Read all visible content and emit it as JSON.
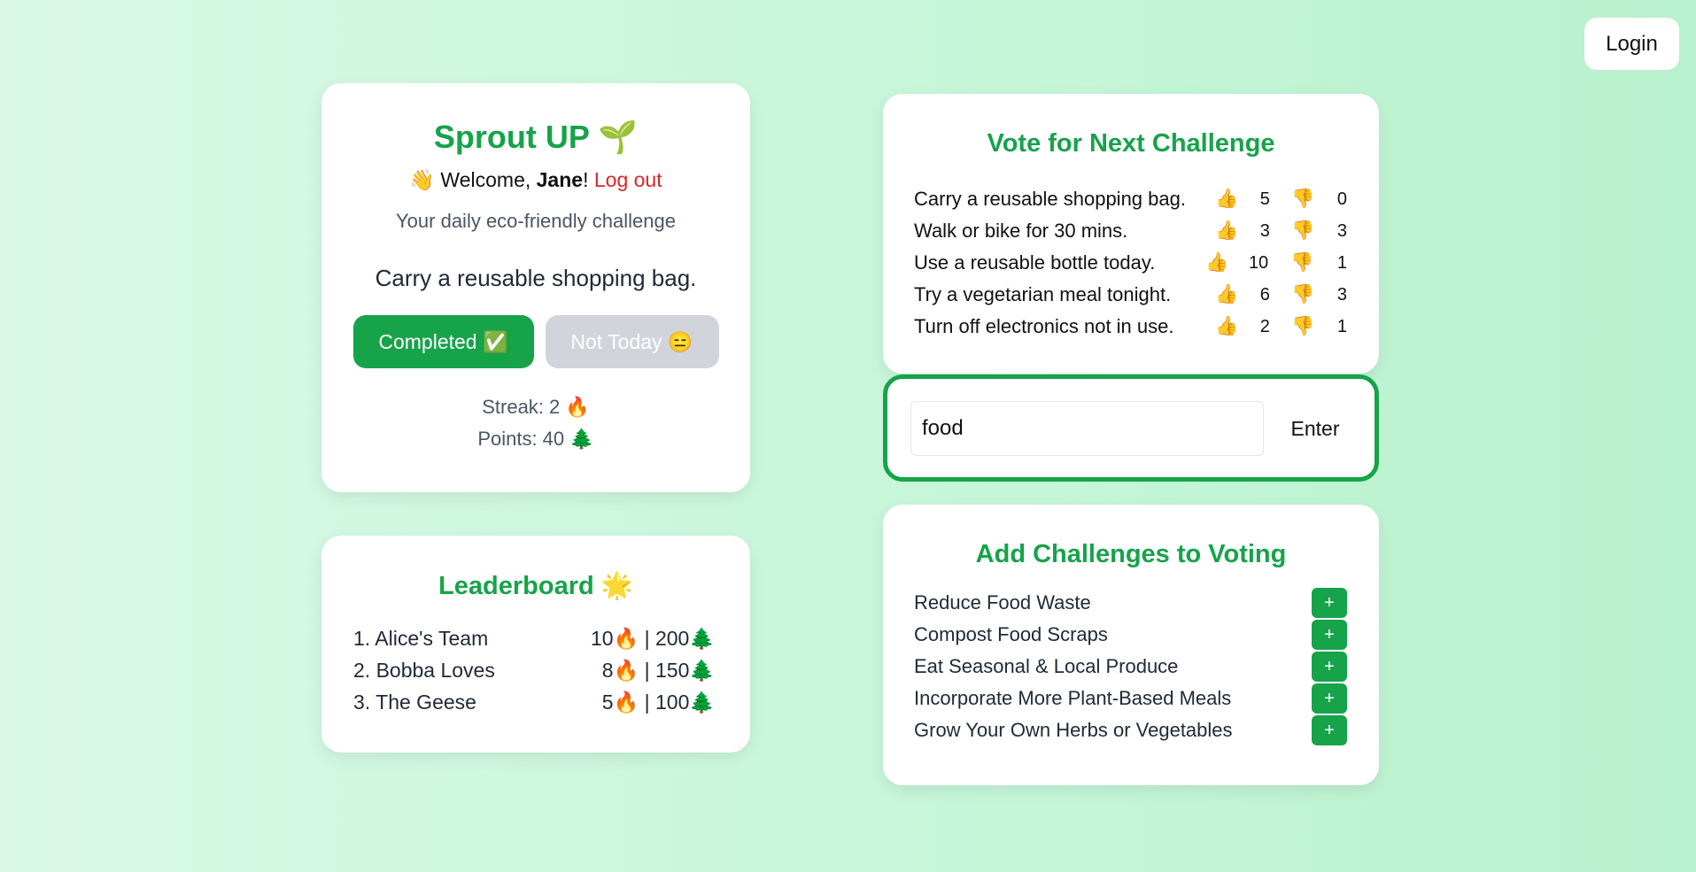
{
  "header": {
    "login_label": "Login"
  },
  "main": {
    "title": "Sprout UP 🌱",
    "welcome_prefix": "👋 Welcome, ",
    "user_name": "Jane",
    "welcome_suffix": "!",
    "logout_label": "Log out",
    "subtitle": "Your daily eco-friendly challenge",
    "challenge": "Carry a reusable shopping bag.",
    "completed_label": "Completed ✅",
    "not_today_label": "Not Today 😑",
    "streak_label": "Streak: 2 🔥",
    "points_label": "Points: 40 🌲"
  },
  "leaderboard": {
    "title": "Leaderboard 🌟",
    "rows": [
      {
        "name": "1. Alice's Team",
        "score": "10🔥 | 200🌲"
      },
      {
        "name": "2. Bobba Loves",
        "score": "8🔥 | 150🌲"
      },
      {
        "name": "3. The Geese",
        "score": "5🔥 | 100🌲"
      }
    ]
  },
  "vote": {
    "title": "Vote for Next Challenge",
    "up_icon": "👍",
    "down_icon": "👎",
    "items": [
      {
        "label": "Carry a reusable shopping bag.",
        "up": "5",
        "down": "0"
      },
      {
        "label": "Walk or bike for 30 mins.",
        "up": "3",
        "down": "3"
      },
      {
        "label": "Use a reusable bottle today.",
        "up": "10",
        "down": "1"
      },
      {
        "label": "Try a vegetarian meal tonight.",
        "up": "6",
        "down": "3"
      },
      {
        "label": "Turn off electronics not in use.",
        "up": "2",
        "down": "1"
      }
    ]
  },
  "search": {
    "value": "food",
    "enter_label": "Enter"
  },
  "add": {
    "title": "Add Challenges to Voting",
    "plus_label": "+",
    "items": [
      "Reduce Food Waste",
      "Compost Food Scraps",
      "Eat Seasonal & Local Produce",
      "Incorporate More Plant-Based Meals",
      "Grow Your Own Herbs or Vegetables"
    ]
  },
  "colors": {
    "accent": "#16a34a",
    "danger": "#dc2626",
    "muted_button": "#d1d5db"
  }
}
